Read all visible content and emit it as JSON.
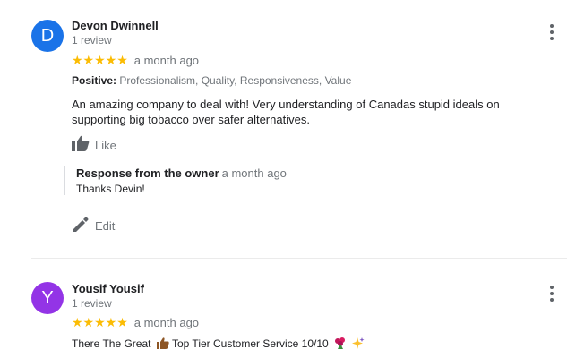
{
  "reviews": [
    {
      "avatar_letter": "D",
      "avatar_color": "#1a73e8",
      "name": "Devon Dwinnell",
      "count": "1 review",
      "stars": "★★★★★",
      "date": "a month ago",
      "attributes_label": "Positive:",
      "attributes_value": "Professionalism, Quality, Responsiveness, Value",
      "text": "An amazing company to deal with! Very understanding of Canadas stupid ideals on supporting big tobacco over safer alternatives.",
      "like_label": "Like",
      "owner_response": {
        "title": "Response from the owner",
        "date": "a month ago",
        "text": "Thanks Devin!"
      },
      "edit_label": "Edit"
    },
    {
      "avatar_letter": "Y",
      "avatar_color": "#9334e6",
      "name": "Yousif Yousif",
      "count": "1 review",
      "stars": "★★★★★",
      "date": "a month ago",
      "text": "There The Great",
      "text_mid": "Top Tier Customer Service 10/10",
      "emojis": [
        "thumbs-up-icon",
        "bouquet-icon",
        "sparkles-icon"
      ]
    }
  ],
  "colors": {
    "star": "#fbbc04",
    "secondary_text": "#70757a",
    "icon_gray": "#5f6368"
  }
}
